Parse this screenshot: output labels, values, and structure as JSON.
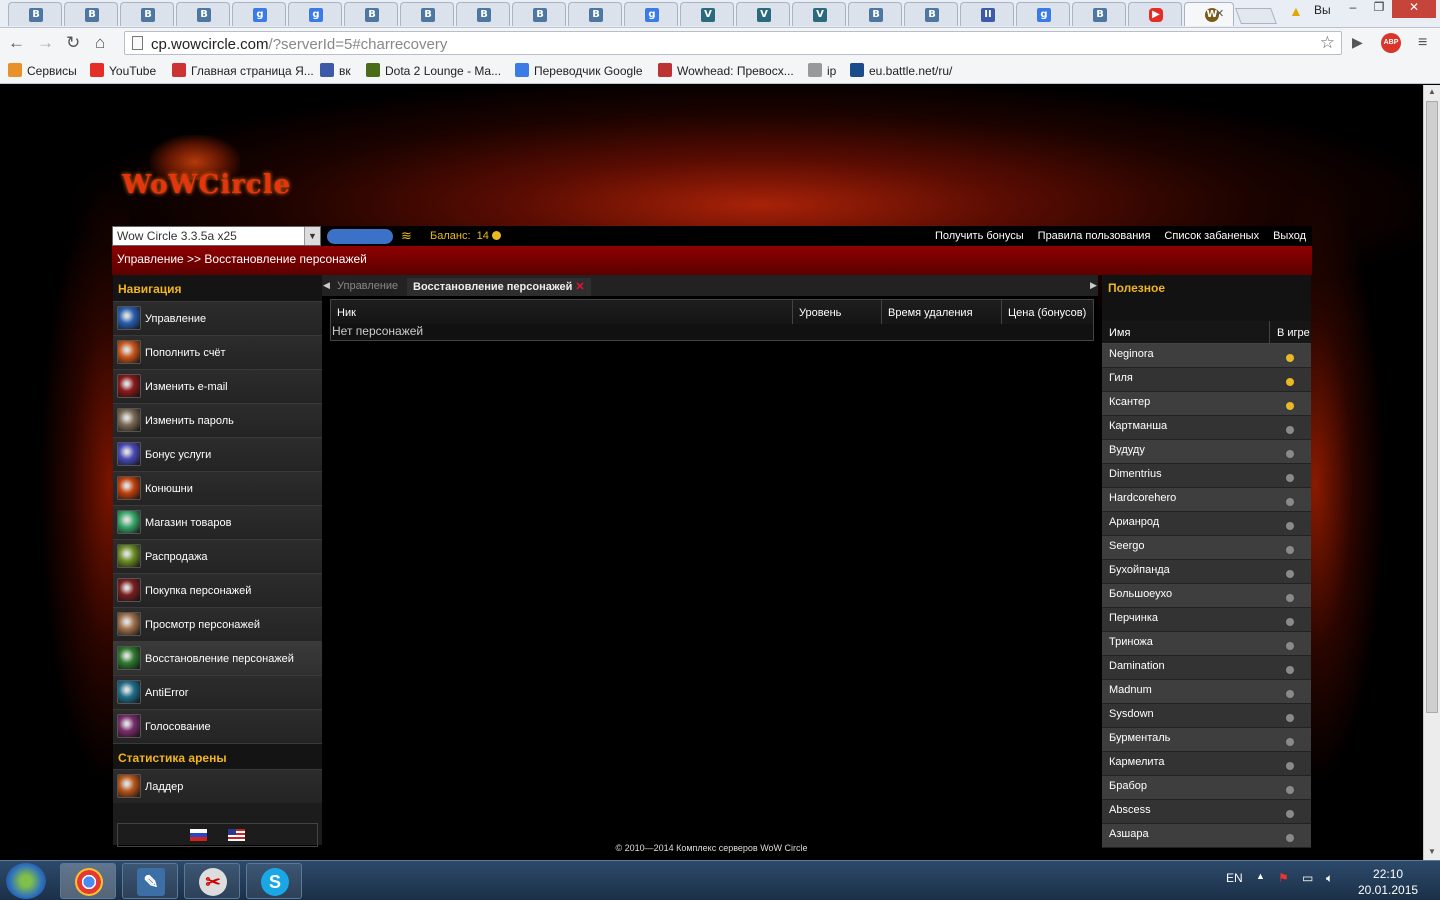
{
  "browser": {
    "url_host": "cp.wowcircle.com",
    "url_path": "/?serverId=5#charrecovery",
    "profile_label": "Вы",
    "tabs": [
      "vk",
      "vk",
      "vk",
      "vk",
      "g",
      "g",
      "vk",
      "vk",
      "vk",
      "vk",
      "vk",
      "g",
      "v",
      "v",
      "v",
      "vk",
      "vk",
      "pz",
      "g",
      "vk",
      "yt",
      "active"
    ],
    "bookmarks": [
      "Сервисы",
      "YouTube",
      "Главная страница Я...",
      "вк",
      "Dota 2 Lounge - Ma...",
      "Переводчик Google",
      "Wowhead: Превосх...",
      "ip",
      "eu.battle.net/ru/"
    ]
  },
  "site": {
    "logo_text": "WoWCircle",
    "realm": "Wow Circle 3.3.5a x25",
    "balance_label": "Баланс:",
    "balance_value": "14",
    "top_links": [
      "Получить бонусы",
      "Правила пользования",
      "Список забаненых",
      "Выход"
    ],
    "breadcrumb": "Управление >> Восстановление персонажей",
    "nav_title": "Навигация",
    "nav_items": [
      {
        "label": "Управление",
        "color": "#2a5fb0"
      },
      {
        "label": "Пополнить счёт",
        "color": "#c9561a"
      },
      {
        "label": "Изменить e-mail",
        "color": "#8b1a1a"
      },
      {
        "label": "Изменить пароль",
        "color": "#7a6a55"
      },
      {
        "label": "Бонус услуги",
        "color": "#4a4ab8"
      },
      {
        "label": "Конюшни",
        "color": "#c2410c"
      },
      {
        "label": "Магазин товаров",
        "color": "#3aa86b"
      },
      {
        "label": "Распродажа",
        "color": "#6b8e23"
      },
      {
        "label": "Покупка персонажей",
        "color": "#7a1f1f"
      },
      {
        "label": "Просмотр персонажей",
        "color": "#a0704a"
      },
      {
        "label": "Восстановление персонажей",
        "color": "#2f7a2f"
      },
      {
        "label": "AntiError",
        "color": "#1f6f8b"
      },
      {
        "label": "Голосование",
        "color": "#7a2d6b"
      }
    ],
    "arena_title": "Статистика арены",
    "arena_items": [
      {
        "label": "Ладдер",
        "color": "#b8561a"
      }
    ],
    "tab_inactive": "Управление",
    "tab_active": "Восстановление персонажей",
    "table_headers": [
      "Ник",
      "Уровень",
      "Время удаления",
      "Цена (бонусов)"
    ],
    "table_empty": "Нет персонажей",
    "footer": "© 2010—2014 Комплекс серверов WoW Circle",
    "right_title": "Полезное",
    "players_headers": [
      "Имя",
      "В игре"
    ],
    "players": [
      {
        "name": "Neginora",
        "online": true
      },
      {
        "name": "Гиля",
        "online": true
      },
      {
        "name": "Ксантер",
        "online": true
      },
      {
        "name": "Картманша",
        "online": false
      },
      {
        "name": "Вудуду",
        "online": false
      },
      {
        "name": "Dimentrius",
        "online": false
      },
      {
        "name": "Hardcorehero",
        "online": false
      },
      {
        "name": "Арианрод",
        "online": false
      },
      {
        "name": "Seergo",
        "online": false
      },
      {
        "name": "Бухойпанда",
        "online": false
      },
      {
        "name": "Большоеухо",
        "online": false
      },
      {
        "name": "Перчинка",
        "online": false
      },
      {
        "name": "Триножа",
        "online": false
      },
      {
        "name": "Damination",
        "online": false
      },
      {
        "name": "Madnum",
        "online": false
      },
      {
        "name": "Sysdown",
        "online": false
      },
      {
        "name": "Бурменталь",
        "online": false
      },
      {
        "name": "Кармелита",
        "online": false
      },
      {
        "name": "Брабор",
        "online": false
      },
      {
        "name": "Abscess",
        "online": false
      },
      {
        "name": "Азшара",
        "online": false
      }
    ]
  },
  "taskbar": {
    "lang": "EN",
    "time": "22:10",
    "date": "20.01.2015"
  }
}
